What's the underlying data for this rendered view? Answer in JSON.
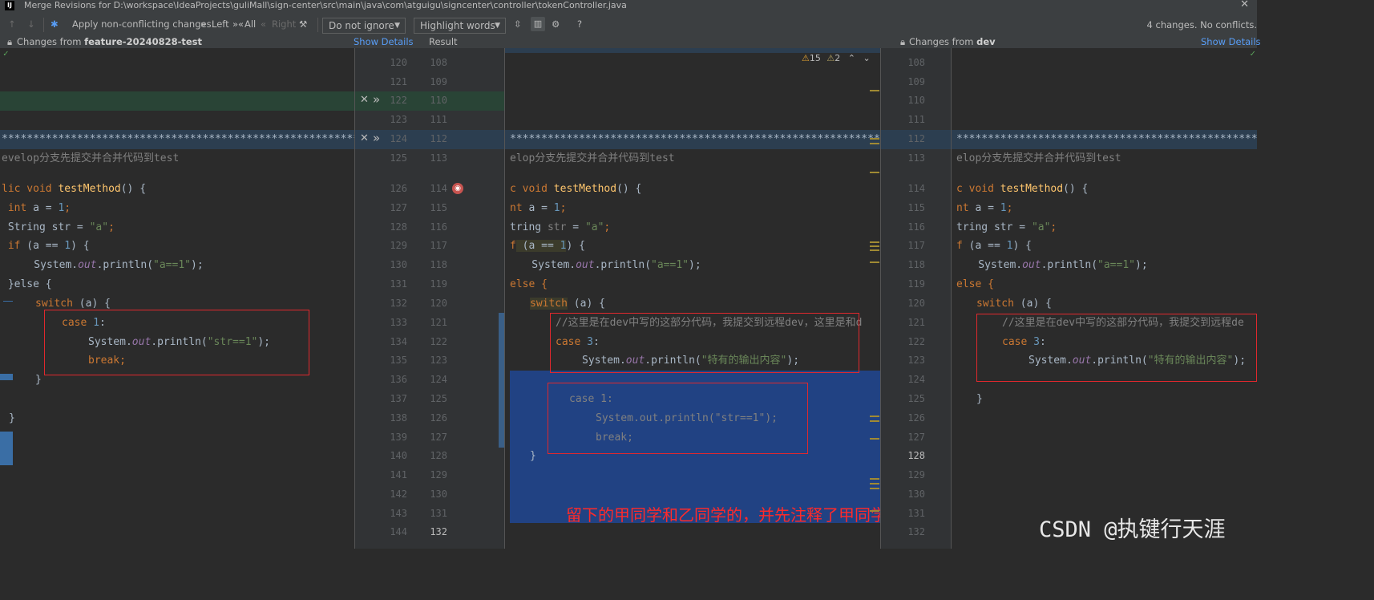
{
  "window": {
    "title": "Merge Revisions for D:\\workspace\\IdeaProjects\\guliMall\\sign-center\\src\\main\\java\\com\\atguigu\\signcenter\\controller\\tokenController.java",
    "icon": "IJ"
  },
  "toolbar": {
    "apply_label": "Apply non-conflicting changes:",
    "left_label": "Left",
    "all_label": "All",
    "right_label": "Right",
    "ignore_dropdown": "Do not ignore",
    "highlight_dropdown": "Highlight words",
    "help": "?",
    "status": "4 changes. No conflicts."
  },
  "headers": {
    "left_prefix": "Changes from ",
    "left_branch": "feature-20240828-test",
    "left_link": "Show Details",
    "result_label": "Result",
    "right_prefix": "Changes from ",
    "right_branch": "dev",
    "right_link": "Show Details"
  },
  "inspection": {
    "warnings": "15",
    "weak_warnings": "2"
  },
  "left_numbers": [
    "120",
    "121",
    "122",
    "123",
    "124",
    "125",
    "",
    "126",
    "127",
    "128",
    "129",
    "130",
    "131",
    "132",
    "133",
    "134",
    "135",
    "136",
    "137",
    "138",
    "139",
    "140",
    "141",
    "142",
    "143",
    "144"
  ],
  "mid_numbers": [
    "108",
    "109",
    "110",
    "111",
    "112",
    "113",
    "",
    "114",
    "115",
    "116",
    "117",
    "118",
    "119",
    "120",
    "121",
    "122",
    "123",
    "124",
    "125",
    "126",
    "127",
    "128",
    "129",
    "130",
    "131",
    "132"
  ],
  "right_numbers": [
    "108",
    "109",
    "110",
    "111",
    "112",
    "113",
    "",
    "114",
    "115",
    "116",
    "117",
    "118",
    "119",
    "120",
    "121",
    "122",
    "123",
    "124",
    "125",
    "126",
    "127",
    "128",
    "129",
    "130",
    "131",
    "132"
  ],
  "code": {
    "stars": "******************************************************************************",
    "left_comment": "evelop分支先提交并合并代码到test",
    "mid_comment": "elop分支先提交并合并代码到test",
    "left_sig": "lic void ",
    "mid_sig": "c void ",
    "method": "testMethod",
    "sig_tail": "() {",
    "left_int": " int",
    "mid_int": "nt",
    "a_decl": " a = ",
    "one": "1",
    "semi": ";",
    "left_string": " String str = ",
    "mid_string": "tring ",
    "str_var": "str",
    "eq": " = ",
    "str_a": "\"a\"",
    "left_if": " if",
    "mid_if": "f",
    "if_cond": " (a == ",
    "if_cond_close": ") {",
    "println_pre": "    System.",
    "out": "out",
    "println": ".println(",
    "str_a1": "\"a==1\"",
    "close_semi": ");",
    "left_else": " }else {",
    "mid_else": "else {",
    "switch_kw": "switch",
    "switch_tail": " (a) {",
    "case1": "case 1:",
    "case3": "case 3:",
    "case_word": "case",
    "str_eq1": "\"str==1\"",
    "brk": "break;",
    "brace": "}",
    "dev_comment": "//这里是在dev中写的这部分代码，我提交到远程dev，这里是和d",
    "dev_comment_right": "//这里是在dev中写的这部分代码，我提交到远程de",
    "special": "\"特有的输出内容\"",
    "commented_case1": "case 1:",
    "commented_println": "System.out.println(\"str==1\");",
    "commented_break": "break;"
  },
  "annotation": "留下的甲同学和乙同学的，并先注释了甲同学的代码",
  "watermark": "CSDN @执键行天涯",
  "colors": {
    "accent_link": "#589df6",
    "conflict_highlight": "#214283",
    "added_green": "#294436",
    "red_box": "#e0282d"
  }
}
